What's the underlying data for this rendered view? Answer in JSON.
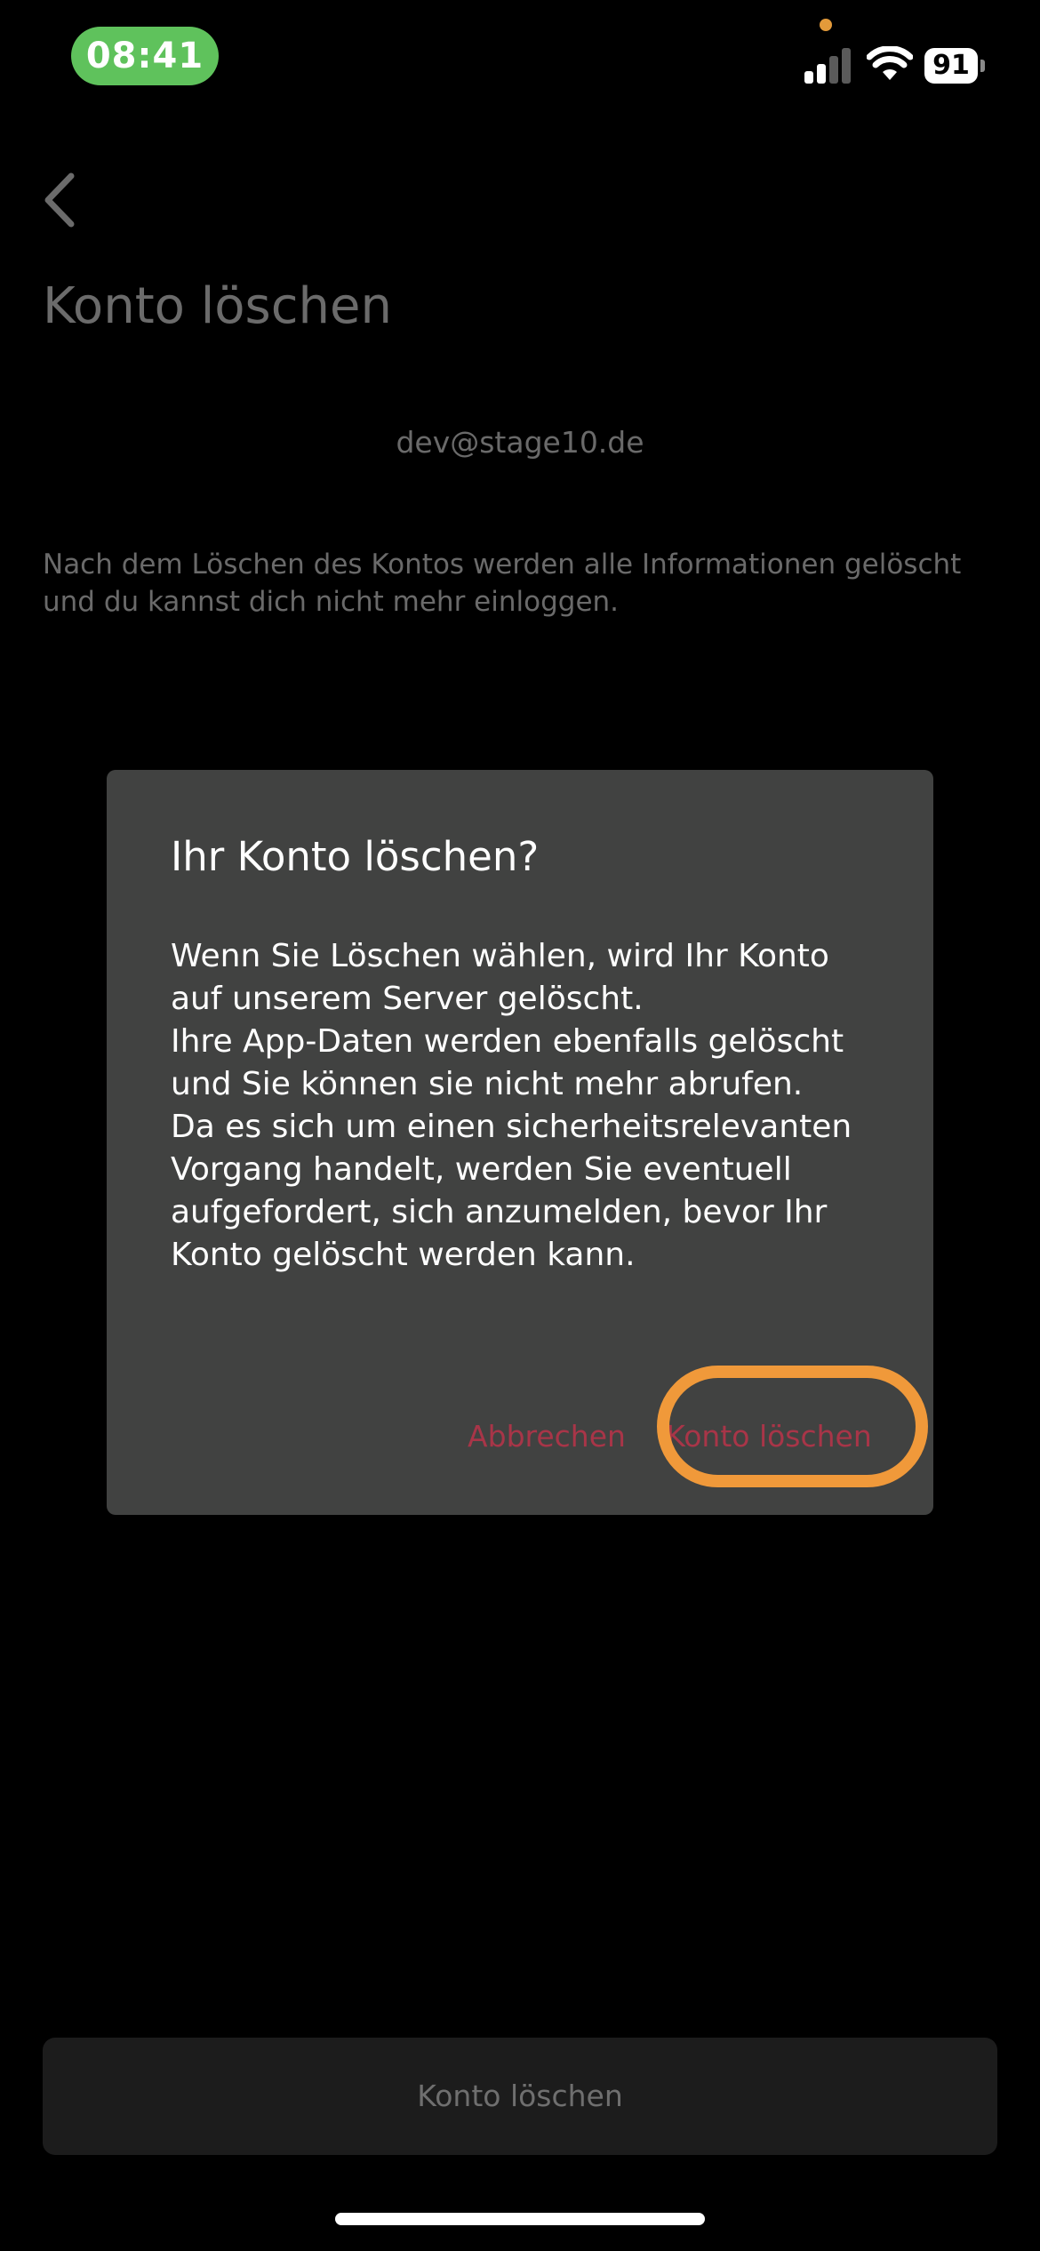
{
  "status_bar": {
    "time": "08:41",
    "battery": "91",
    "colors": {
      "time_pill": "#5fc25c",
      "privacy_dot": "#e39a3a"
    },
    "icons": [
      "signal-icon",
      "wifi-icon",
      "battery-icon"
    ],
    "signal_bars_filled": 2,
    "signal_bars_total": 4
  },
  "page": {
    "back_icon": "chevron-left-icon",
    "title": "Konto löschen",
    "email": "dev@stage10.de",
    "info_text": "Nach dem Löschen des Kontos werden alle Informationen gelöscht und du kannst dich nicht mehr einloggen.",
    "delete_button_label": "Konto löschen"
  },
  "dialog": {
    "title": "Ihr Konto löschen?",
    "body_lines": [
      "Wenn Sie Löschen wählen, wird Ihr Konto",
      "auf unserem Server gelöscht.",
      "Ihre App-Daten werden ebenfalls gelöscht",
      "und Sie können sie nicht mehr abrufen.",
      "Da es sich um einen sicherheitsrelevanten",
      "Vorgang handelt, werden Sie eventuell",
      "aufgefordert, sich anzumelden, bevor Ihr",
      "Konto gelöscht werden kann."
    ],
    "cancel_label": "Abbrechen",
    "confirm_label": "Konto löschen",
    "colors": {
      "background": "#414241",
      "action_text": "#a83548",
      "highlight_ring": "#f0993a"
    }
  }
}
